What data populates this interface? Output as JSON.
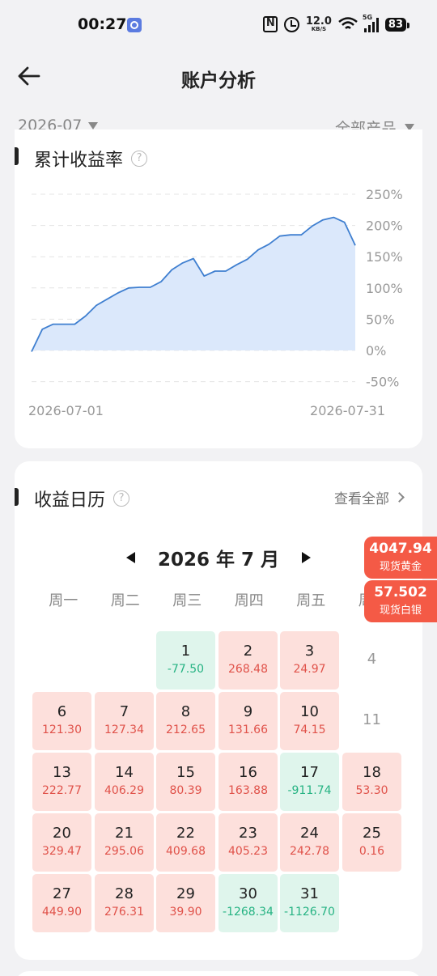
{
  "status_bar": {
    "time": "00:27",
    "net_speed": "12.0",
    "net_unit": "KB/S",
    "network_type": "5G",
    "battery": "83"
  },
  "header": {
    "title": "账户分析"
  },
  "filters": {
    "month": "2026-07",
    "product": "全部产品"
  },
  "chart_section": {
    "title": "累计收益率",
    "help": "?"
  },
  "chart_data": {
    "type": "area",
    "title": "累计收益率",
    "x_start_label": "2026-07-01",
    "x_end_label": "2026-07-31",
    "y_ticks": [
      "250%",
      "200%",
      "150%",
      "100%",
      "50%",
      "0%",
      "-50%"
    ],
    "ylim": [
      -50,
      250
    ],
    "grid": true,
    "legend": "none",
    "line_color": "#3f7fd0",
    "fill_color": "#dbe8fb",
    "series": [
      {
        "values": [
          -2,
          34,
          42,
          42,
          42,
          55,
          72,
          82,
          92,
          100,
          101,
          101,
          110,
          129,
          140,
          147,
          119,
          127,
          127,
          137,
          146,
          161,
          170,
          183,
          185,
          185,
          199,
          209,
          213,
          205,
          168
        ]
      }
    ]
  },
  "calendar_section": {
    "title": "收益日历",
    "help": "?",
    "view_all": "查看全部"
  },
  "calendar": {
    "month_label": "2026 年 7 月",
    "weekdays": [
      "周一",
      "周二",
      "周三",
      "周四",
      "周五",
      "周六"
    ],
    "days": [
      {
        "day": "1",
        "value": "-77.50",
        "status": "neg"
      },
      {
        "day": "2",
        "value": "268.48",
        "status": "pos"
      },
      {
        "day": "3",
        "value": "24.97",
        "status": "pos"
      },
      {
        "day": "4",
        "value": "",
        "status": "none"
      },
      {
        "day": "6",
        "value": "121.30",
        "status": "pos"
      },
      {
        "day": "7",
        "value": "127.34",
        "status": "pos"
      },
      {
        "day": "8",
        "value": "212.65",
        "status": "pos"
      },
      {
        "day": "9",
        "value": "131.66",
        "status": "pos"
      },
      {
        "day": "10",
        "value": "74.15",
        "status": "pos"
      },
      {
        "day": "11",
        "value": "",
        "status": "none"
      },
      {
        "day": "13",
        "value": "222.77",
        "status": "pos"
      },
      {
        "day": "14",
        "value": "406.29",
        "status": "pos"
      },
      {
        "day": "15",
        "value": "80.39",
        "status": "pos"
      },
      {
        "day": "16",
        "value": "163.88",
        "status": "pos"
      },
      {
        "day": "17",
        "value": "-911.74",
        "status": "neg"
      },
      {
        "day": "18",
        "value": "53.30",
        "status": "pos"
      },
      {
        "day": "20",
        "value": "329.47",
        "status": "pos"
      },
      {
        "day": "21",
        "value": "295.06",
        "status": "pos"
      },
      {
        "day": "22",
        "value": "409.68",
        "status": "pos"
      },
      {
        "day": "23",
        "value": "405.23",
        "status": "pos"
      },
      {
        "day": "24",
        "value": "242.78",
        "status": "pos"
      },
      {
        "day": "25",
        "value": "0.16",
        "status": "pos"
      },
      {
        "day": "27",
        "value": "449.90",
        "status": "pos"
      },
      {
        "day": "28",
        "value": "276.31",
        "status": "pos"
      },
      {
        "day": "29",
        "value": "39.90",
        "status": "pos"
      },
      {
        "day": "30",
        "value": "-1268.34",
        "status": "neg"
      },
      {
        "day": "31",
        "value": "-1126.70",
        "status": "neg"
      }
    ]
  },
  "floating_tags": [
    {
      "price": "4047.94",
      "name": "现货黄金"
    },
    {
      "price": "57.502",
      "name": "现货白银"
    }
  ],
  "colors": {
    "profit": "#e0524a",
    "profit_bg": "#fde0dc",
    "loss": "#26b383",
    "loss_bg": "#dff5ec",
    "tag": "#f45a46"
  }
}
